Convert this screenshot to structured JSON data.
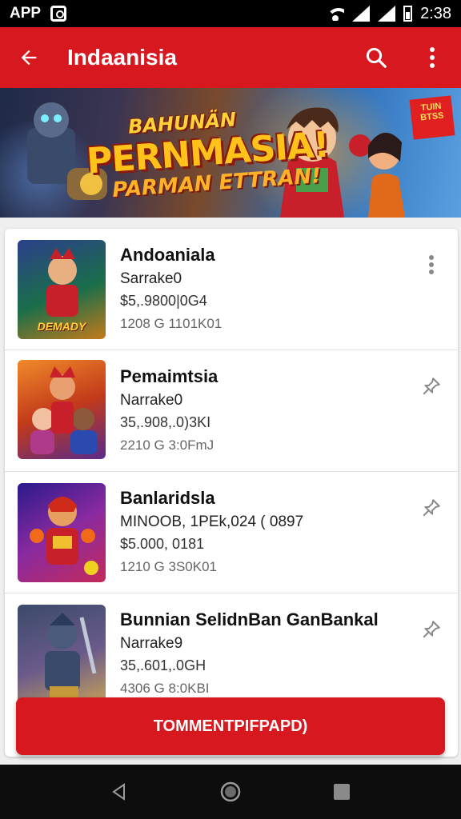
{
  "status": {
    "app_label": "APP",
    "time": "2:38"
  },
  "header": {
    "title": "Indaanisia"
  },
  "banner": {
    "line1": "BAHUNÄN",
    "line2": "PERNMASIA!",
    "line3": "PARMAN ETTRAN!",
    "badge": "TUIN BTSS"
  },
  "items": [
    {
      "title": "Andoaniala",
      "subtitle": "Sarrake0",
      "price": "$5,.9800|0G4",
      "meta": "1208  G   1101K01",
      "thumb_caption": "DEMADY",
      "action_icon": "more-vert-icon",
      "colors": [
        "#2b3f8a",
        "#1a6e4a",
        "#c47a1a"
      ]
    },
    {
      "title": "Pemaimtsia",
      "subtitle": "Narrake0",
      "price": "35,.908,.0)3KI",
      "meta": "2210  G   3:0FmJ",
      "thumb_caption": "",
      "action_icon": "pin-icon",
      "colors": [
        "#c23a1a",
        "#f08a2a",
        "#5a2a8a"
      ]
    },
    {
      "title": "Banlaridsla",
      "subtitle": "MINOOB, 1PEk,024 ( 0897",
      "price": "$5.000, 0181",
      "meta": "1210  G   3S0K01",
      "thumb_caption": "",
      "action_icon": "pin-icon",
      "colors": [
        "#2a1a8a",
        "#c42a5a",
        "#8a2aa0"
      ]
    },
    {
      "title": "Bunnian SelidnBan GanBankal",
      "subtitle": "Narrake9",
      "price": "35,.601,.0GH",
      "meta": "4306  G   8:0KBI",
      "thumb_caption": "",
      "action_icon": "pin-icon",
      "colors": [
        "#3a4a6a",
        "#6a5a8a",
        "#c4a05a"
      ]
    }
  ],
  "cta": {
    "label": "TOMMENTPIFPAPD)"
  },
  "colors": {
    "primary": "#d7191f",
    "status_bar": "#000000",
    "nav_bar": "#0d0d0d"
  }
}
